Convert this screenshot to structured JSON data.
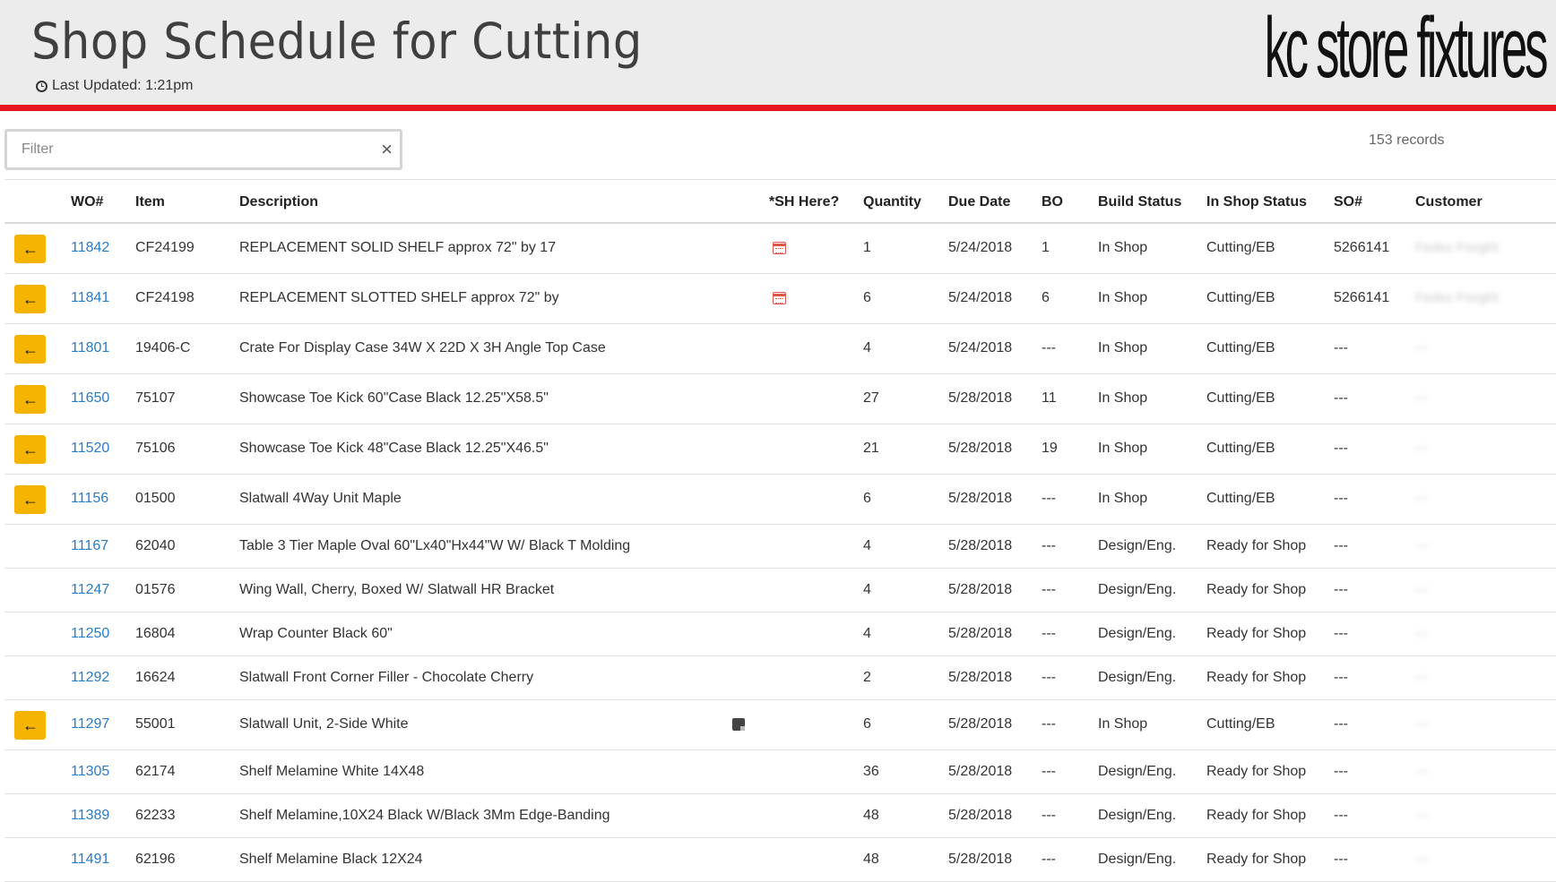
{
  "header": {
    "title": "Shop Schedule for Cutting",
    "last_updated": "Last Updated: 1:21pm",
    "logo_text": "kc store fixtures",
    "accent_color": "#e8171f"
  },
  "filter": {
    "placeholder": "Filter",
    "clear_label": "×",
    "records": "153 records"
  },
  "columns": [
    "WO#",
    "Item",
    "Description",
    "*SH Here?",
    "Quantity",
    "Due Date",
    "BO",
    "Build Status",
    "In Shop Status",
    "SO#",
    "Customer"
  ],
  "rows": [
    {
      "arrow": true,
      "wo": "11842",
      "item": "CF24199",
      "desc": "REPLACEMENT SOLID SHELF approx 72\" by 17",
      "sh": "calendar-icon",
      "qty": "1",
      "due": "5/24/2018",
      "bo": "1",
      "build": "In Shop",
      "shop": "Cutting/EB",
      "so": "5266141",
      "cust": "Fedex Freight"
    },
    {
      "arrow": true,
      "wo": "11841",
      "item": "CF24198",
      "desc": "REPLACEMENT SLOTTED SHELF approx 72\" by",
      "sh": "calendar-icon",
      "qty": "6",
      "due": "5/24/2018",
      "bo": "6",
      "build": "In Shop",
      "shop": "Cutting/EB",
      "so": "5266141",
      "cust": "Fedex Freight"
    },
    {
      "arrow": true,
      "wo": "11801",
      "item": "19406-C",
      "desc": "Crate For Display Case 34W X 22D X 3H Angle Top Case",
      "sh": "",
      "qty": "4",
      "due": "5/24/2018",
      "bo": "---",
      "build": "In Shop",
      "shop": "Cutting/EB",
      "so": "---",
      "cust": "---"
    },
    {
      "arrow": true,
      "wo": "11650",
      "item": "75107",
      "desc": "Showcase Toe Kick 60\"Case Black 12.25\"X58.5\"",
      "sh": "",
      "qty": "27",
      "due": "5/28/2018",
      "bo": "11",
      "build": "In Shop",
      "shop": "Cutting/EB",
      "so": "---",
      "cust": "---"
    },
    {
      "arrow": true,
      "wo": "11520",
      "item": "75106",
      "desc": "Showcase Toe Kick 48\"Case Black 12.25\"X46.5\"",
      "sh": "",
      "qty": "21",
      "due": "5/28/2018",
      "bo": "19",
      "build": "In Shop",
      "shop": "Cutting/EB",
      "so": "---",
      "cust": "---"
    },
    {
      "arrow": true,
      "wo": "11156",
      "item": "01500",
      "desc": "Slatwall 4Way Unit Maple",
      "sh": "",
      "qty": "6",
      "due": "5/28/2018",
      "bo": "---",
      "build": "In Shop",
      "shop": "Cutting/EB",
      "so": "---",
      "cust": "---"
    },
    {
      "arrow": false,
      "wo": "11167",
      "item": "62040",
      "desc": "Table 3 Tier Maple Oval 60\"Lx40\"Hx44\"W W/ Black T Molding",
      "sh": "",
      "qty": "4",
      "due": "5/28/2018",
      "bo": "---",
      "build": "Design/Eng.",
      "shop": "Ready for Shop",
      "so": "---",
      "cust": "---"
    },
    {
      "arrow": false,
      "wo": "11247",
      "item": "01576",
      "desc": "Wing Wall, Cherry, Boxed W/ Slatwall HR Bracket",
      "sh": "",
      "qty": "4",
      "due": "5/28/2018",
      "bo": "---",
      "build": "Design/Eng.",
      "shop": "Ready for Shop",
      "so": "---",
      "cust": "---"
    },
    {
      "arrow": false,
      "wo": "11250",
      "item": "16804",
      "desc": "Wrap Counter Black 60\"",
      "sh": "",
      "qty": "4",
      "due": "5/28/2018",
      "bo": "---",
      "build": "Design/Eng.",
      "shop": "Ready for Shop",
      "so": "---",
      "cust": "---"
    },
    {
      "arrow": false,
      "wo": "11292",
      "item": "16624",
      "desc": "Slatwall Front Corner Filler - Chocolate Cherry",
      "sh": "",
      "qty": "2",
      "due": "5/28/2018",
      "bo": "---",
      "build": "Design/Eng.",
      "shop": "Ready for Shop",
      "so": "---",
      "cust": "---"
    },
    {
      "arrow": true,
      "wo": "11297",
      "item": "55001",
      "desc": "Slatwall Unit, 2-Side White",
      "sh": "note-icon",
      "qty": "6",
      "due": "5/28/2018",
      "bo": "---",
      "build": "In Shop",
      "shop": "Cutting/EB",
      "so": "---",
      "cust": "---"
    },
    {
      "arrow": false,
      "wo": "11305",
      "item": "62174",
      "desc": "Shelf Melamine White 14X48",
      "sh": "",
      "qty": "36",
      "due": "5/28/2018",
      "bo": "---",
      "build": "Design/Eng.",
      "shop": "Ready for Shop",
      "so": "---",
      "cust": "---"
    },
    {
      "arrow": false,
      "wo": "11389",
      "item": "62233",
      "desc": "Shelf Melamine,10X24 Black W/Black 3Mm Edge-Banding",
      "sh": "",
      "qty": "48",
      "due": "5/28/2018",
      "bo": "---",
      "build": "Design/Eng.",
      "shop": "Ready for Shop",
      "so": "---",
      "cust": "---"
    },
    {
      "arrow": false,
      "wo": "11491",
      "item": "62196",
      "desc": "Shelf Melamine Black 12X24",
      "sh": "",
      "qty": "48",
      "due": "5/28/2018",
      "bo": "---",
      "build": "Design/Eng.",
      "shop": "Ready for Shop",
      "so": "---",
      "cust": "---"
    }
  ]
}
